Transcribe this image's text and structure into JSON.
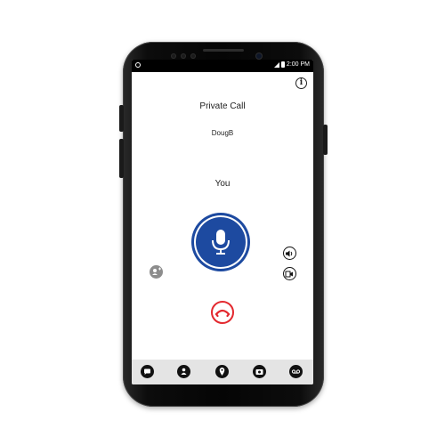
{
  "statusbar": {
    "time": "2:00 PM"
  },
  "call": {
    "title": "Private Call",
    "contact": "DougB",
    "talker": "You"
  },
  "icons": {
    "info": "i",
    "nfc": "nfc-icon",
    "signal": "signal-icon",
    "battery": "battery-icon",
    "mic": "microphone-icon",
    "add_participant": "add-participant-icon",
    "speaker": "speaker-icon",
    "mute": "mute-toggle-icon",
    "end_call": "end-call-icon"
  },
  "nav": [
    "chat-icon",
    "talkgroup-icon",
    "location-icon",
    "camera-icon",
    "voicemail-icon"
  ],
  "colors": {
    "mic": "#1d4aa0",
    "end_call": "#e3282e",
    "navbar": "#e4e4e4"
  }
}
